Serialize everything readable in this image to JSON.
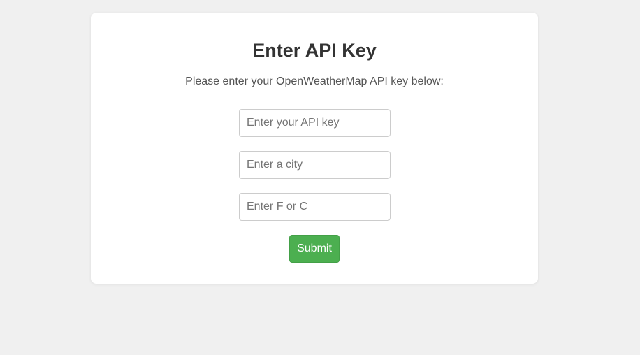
{
  "form": {
    "title": "Enter API Key",
    "subtitle": "Please enter your OpenWeatherMap API key below:",
    "api_key_placeholder": "Enter your API key",
    "city_placeholder": "Enter a city",
    "unit_placeholder": "Enter F or C",
    "submit_label": "Submit"
  },
  "colors": {
    "background": "#f0f0f0",
    "card": "#ffffff",
    "submit_button": "#4caf50"
  }
}
